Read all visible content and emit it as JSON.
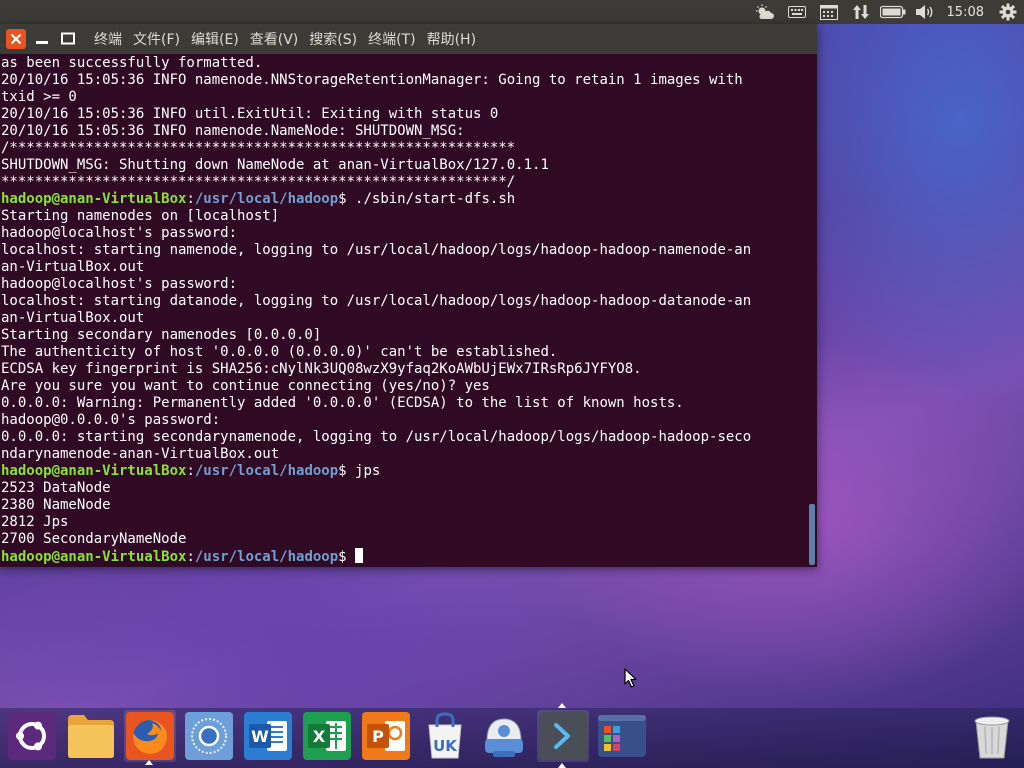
{
  "top_panel": {
    "clock": "15:08",
    "indicators": [
      "weather-icon",
      "keyboard-icon",
      "calendar-icon",
      "network-transfer-icon",
      "battery-icon",
      "volume-icon",
      "system-gear-icon"
    ]
  },
  "terminal": {
    "menu": [
      "终端",
      "文件(F)",
      "编辑(E)",
      "查看(V)",
      "搜索(S)",
      "终端(T)",
      "帮助(H)"
    ],
    "lines": [
      {
        "text": "as been successfully formatted."
      },
      {
        "text": "20/10/16 15:05:36 INFO namenode.NNStorageRetentionManager: Going to retain 1 images with"
      },
      {
        "text": "txid >= 0"
      },
      {
        "text": "20/10/16 15:05:36 INFO util.ExitUtil: Exiting with status 0"
      },
      {
        "text": "20/10/16 15:05:36 INFO namenode.NameNode: SHUTDOWN_MSG:"
      },
      {
        "text": "/************************************************************"
      },
      {
        "text": "SHUTDOWN_MSG: Shutting down NameNode at anan-VirtualBox/127.0.1.1"
      },
      {
        "text": "************************************************************/"
      },
      {
        "prompt": {
          "user": "hadoop@anan-VirtualBox",
          "path": "/usr/local/hadoop",
          "symbol": "$ "
        },
        "text": "./sbin/start-dfs.sh"
      },
      {
        "text": "Starting namenodes on [localhost]"
      },
      {
        "text": "hadoop@localhost's password:"
      },
      {
        "text": "localhost: starting namenode, logging to /usr/local/hadoop/logs/hadoop-hadoop-namenode-an"
      },
      {
        "text": "an-VirtualBox.out"
      },
      {
        "text": "hadoop@localhost's password:"
      },
      {
        "text": "localhost: starting datanode, logging to /usr/local/hadoop/logs/hadoop-hadoop-datanode-an"
      },
      {
        "text": "an-VirtualBox.out"
      },
      {
        "text": "Starting secondary namenodes [0.0.0.0]"
      },
      {
        "text": "The authenticity of host '0.0.0.0 (0.0.0.0)' can't be established."
      },
      {
        "text": "ECDSA key fingerprint is SHA256:cNylNk3UQ08wzX9yfaq2KoAWbUjEWx7IRsRp6JYFYO8."
      },
      {
        "text": "Are you sure you want to continue connecting (yes/no)? yes"
      },
      {
        "text": "0.0.0.0: Warning: Permanently added '0.0.0.0' (ECDSA) to the list of known hosts."
      },
      {
        "text": "hadoop@0.0.0.0's password:"
      },
      {
        "text": "0.0.0.0: starting secondarynamenode, logging to /usr/local/hadoop/logs/hadoop-hadoop-seco"
      },
      {
        "text": "ndarynamenode-anan-VirtualBox.out"
      },
      {
        "prompt": {
          "user": "hadoop@anan-VirtualBox",
          "path": "/usr/local/hadoop",
          "symbol": "$ "
        },
        "text": "jps"
      },
      {
        "text": "2523 DataNode"
      },
      {
        "text": "2380 NameNode"
      },
      {
        "text": "2812 Jps"
      },
      {
        "text": "2700 SecondaryNameNode"
      },
      {
        "prompt": {
          "user": "hadoop@anan-VirtualBox",
          "path": "/usr/local/hadoop",
          "symbol": "$ "
        },
        "text": "",
        "cursor": true
      }
    ]
  },
  "dock": {
    "items": [
      {
        "name": "ubuntu-dash-icon"
      },
      {
        "name": "files-icon"
      },
      {
        "name": "firefox-icon",
        "running": true
      },
      {
        "name": "browser-icon"
      },
      {
        "name": "writer-icon",
        "label": "W"
      },
      {
        "name": "spreadsheet-icon",
        "label": "X"
      },
      {
        "name": "presentation-icon",
        "label": "P"
      },
      {
        "name": "software-center-icon",
        "label": "UK"
      },
      {
        "name": "update-manager-icon"
      },
      {
        "name": "terminal-icon",
        "running": true,
        "active": true
      },
      {
        "name": "workspace-switcher-icon"
      },
      {
        "name": "trash-icon"
      }
    ]
  },
  "colors": {
    "terminal_bg": "#300a24",
    "prompt_user": "#8ae234",
    "prompt_path": "#729fcf",
    "close_button": "#e9541e",
    "panel_bg": "#3c3b37"
  }
}
